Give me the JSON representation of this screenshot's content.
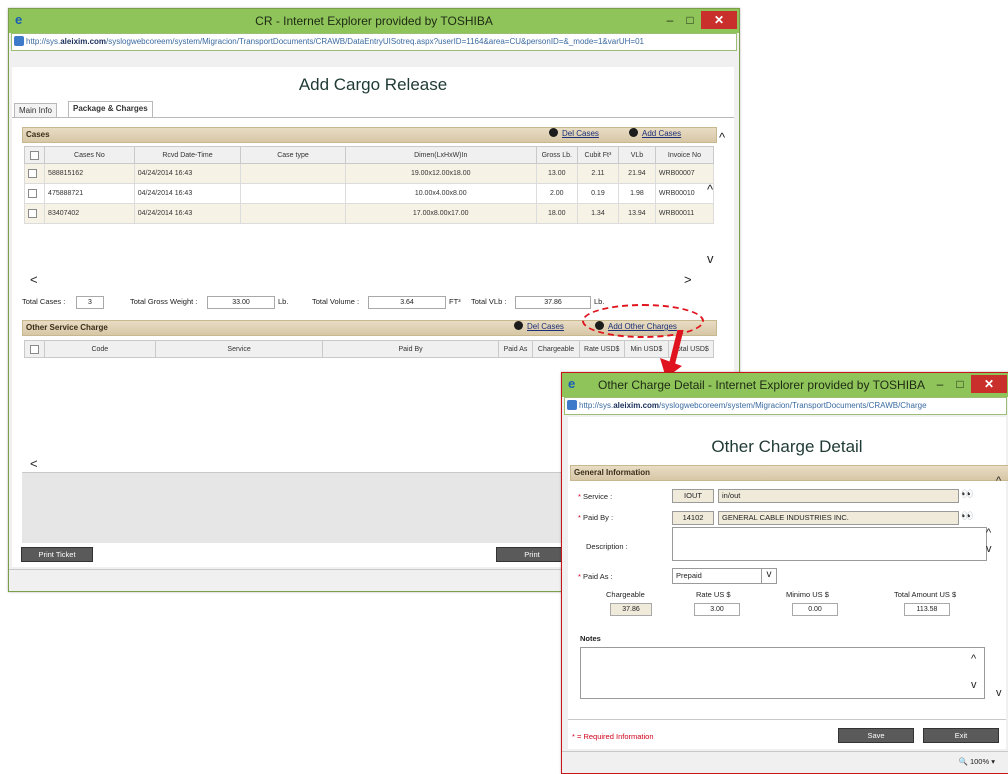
{
  "main_window": {
    "title": "CR - Internet Explorer provided by TOSHIBA",
    "controls": {
      "minimize": "–",
      "maximize": "□",
      "close": "✕"
    },
    "address_prefix": "http://sys.",
    "address_host": "aleixim.com",
    "address_path": "/syslogwebcoreem/system/Migracion/TransportDocuments/CRAWB/DataEntryUISotreq.aspx?userID=1164&area=CU&personID=&_mode=1&varUH=01",
    "page_title": "Add Cargo Release",
    "tabs": [
      "Main Info",
      "Package & Charges"
    ],
    "cases": {
      "header": "Cases",
      "del_label": "Del Cases",
      "add_label": "Add Cases",
      "columns": [
        "Cases No",
        "Rcvd Date-Time",
        "Case type",
        "Dimen(LxHxW)In",
        "Gross Lb.",
        "Cubit Ft³",
        "VLb",
        "Invoice No"
      ],
      "rows": [
        [
          "588815162",
          "04/24/2014 16:43",
          "",
          "19.00x12.00x18.00",
          "13.00",
          "2.11",
          "21.94",
          "WRB00007"
        ],
        [
          "475888721",
          "04/24/2014 16:43",
          "",
          "10.00x4.00x8.00",
          "2.00",
          "0.19",
          "1.98",
          "WRB00010"
        ],
        [
          "83407402",
          "04/24/2014 16:43",
          "",
          "17.00x8.00x17.00",
          "18.00",
          "1.34",
          "13.94",
          "WRB00011"
        ]
      ]
    },
    "totals": {
      "cases_label": "Total Cases :",
      "cases_value": "3",
      "gross_label": "Total Gross Weight :",
      "gross_value": "33.00",
      "gross_unit": "Lb.",
      "volume_label": "Total Volume :",
      "volume_value": "3.64",
      "volume_unit": "FT³",
      "vlb_label": "Total VLb :",
      "vlb_value": "37.86",
      "vlb_unit": "Lb."
    },
    "other_charges": {
      "header": "Other Service Charge",
      "del_label": "Del Cases",
      "add_label": "Add Other Charges",
      "columns": [
        "Code",
        "Service",
        "Paid By",
        "Paid As",
        "Chargeable",
        "Rate USD$",
        "Min USD$",
        "Total USD$"
      ]
    },
    "buttons": {
      "print_ticket": "Print Ticket",
      "print": "Print"
    }
  },
  "detail_window": {
    "title": "Other Charge Detail - Internet Explorer provided by TOSHIBA",
    "controls": {
      "minimize": "–",
      "maximize": "□",
      "close": "✕"
    },
    "address_prefix": "http://sys.",
    "address_host": "aleixim.com",
    "address_path": "/syslogwebcoreem/system/Migracion/TransportDocuments/CRAWB/Charge",
    "page_title": "Other Charge Detail",
    "section": "General Information",
    "service_label": "Service :",
    "service_code": "IOUT",
    "service_name": "in/out",
    "paid_by_label": "Paid By :",
    "paid_by_code": "14102",
    "paid_by_name": "GENERAL CABLE INDUSTRIES INC.",
    "description_label": "Description :",
    "paid_as_label": "Paid As :",
    "paid_as_value": "Prepaid",
    "amounts": [
      {
        "label": "Chargeable",
        "value": "37.86"
      },
      {
        "label": "Rate US $",
        "value": "3.00"
      },
      {
        "label": "Minimo US $",
        "value": "0.00"
      },
      {
        "label": "Total Amount US $",
        "value": "113.58"
      }
    ],
    "notes_label": "Notes",
    "required_note": "* = Required Information",
    "save_label": "Save",
    "exit_label": "Exit",
    "zoom": "100%"
  },
  "colors": {
    "titlebar": "#8fc45a",
    "section": "#d7c7a6",
    "callout": "#e0141e",
    "close": "#c9302c"
  }
}
